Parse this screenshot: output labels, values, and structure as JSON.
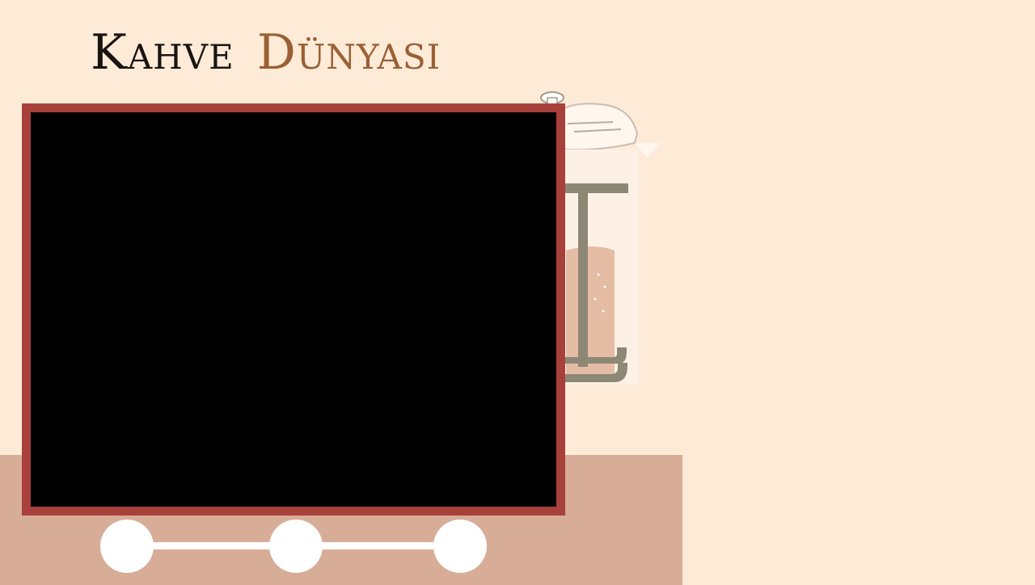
{
  "header": {
    "title_part1": "Kahve",
    "title_part2": "Dünyası"
  },
  "colors": {
    "background": "#fdebd8",
    "table": "#d7ad97",
    "frame_border": "#a8403b",
    "title_dark": "#1a1410",
    "title_accent": "#9a6034"
  },
  "media": {
    "icon": "french-press-illustration"
  },
  "slider": {
    "step_count": 3,
    "icon": "slider-dot"
  }
}
